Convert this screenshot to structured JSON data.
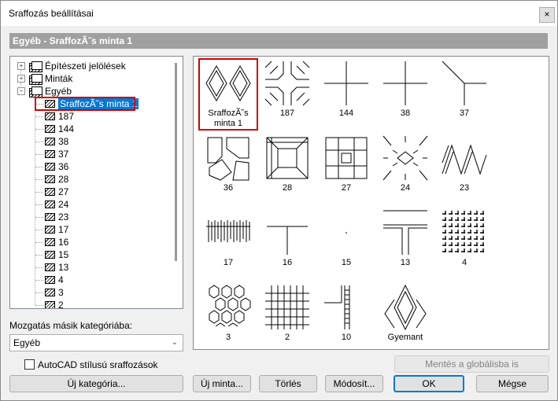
{
  "window": {
    "title": "Sraffozás beállításai",
    "close_glyph": "×"
  },
  "header": {
    "title": "Egyéb - SraffozÃ˜s minta 1"
  },
  "tree": {
    "categories": [
      {
        "label": "Építészeti jelölések",
        "expander": "+"
      },
      {
        "label": "Minták",
        "expander": "+"
      },
      {
        "label": "Egyéb",
        "expander": "−"
      }
    ],
    "children": [
      "SraffozÃ˜s minta 1",
      "187",
      "144",
      "38",
      "37",
      "36",
      "28",
      "27",
      "24",
      "23",
      "17",
      "16",
      "15",
      "13",
      "4",
      "3",
      "2"
    ],
    "selected": "SraffozÃ˜s minta 1"
  },
  "move": {
    "label": "Mozgatás másik kategóriába:",
    "value": "Egyéb",
    "chevron": "⌄"
  },
  "autocad": {
    "label": "AutoCAD stílusú sraffozások",
    "checked": false
  },
  "patterns": [
    {
      "name": "SraffozÃ˜s\nminta 1",
      "icon": "diamonds-icon"
    },
    {
      "name": "187",
      "icon": "cross-corners-icon"
    },
    {
      "name": "144",
      "icon": "cross-lines-icon"
    },
    {
      "name": "38",
      "icon": "cross-lines-icon"
    },
    {
      "name": "37",
      "icon": "corner-icon"
    },
    {
      "name": "36",
      "icon": "stones-icon"
    },
    {
      "name": "28",
      "icon": "square-frame-icon"
    },
    {
      "name": "27",
      "icon": "tile-icon"
    },
    {
      "name": "24",
      "icon": "star-icon"
    },
    {
      "name": "23",
      "icon": "zigzag-icon"
    },
    {
      "name": "17",
      "icon": "grass-icon"
    },
    {
      "name": "16",
      "icon": "tee-icon"
    },
    {
      "name": "15",
      "icon": "dot-icon"
    },
    {
      "name": "13",
      "icon": "double-tee-icon"
    },
    {
      "name": "4",
      "icon": "weave-icon"
    },
    {
      "name": "3",
      "icon": "hexagon-icon"
    },
    {
      "name": "2",
      "icon": "grid-icon"
    },
    {
      "name": "10",
      "icon": "ladder-icon"
    },
    {
      "name": "Gyemant",
      "icon": "diamond-icon"
    }
  ],
  "buttons": {
    "save_global": "Mentés a globálisba is",
    "new_category": "Új kategória...",
    "new_pattern": "Új minta...",
    "delete": "Törlés",
    "modify": "Módosít...",
    "ok": "OK",
    "cancel": "Mégse"
  }
}
